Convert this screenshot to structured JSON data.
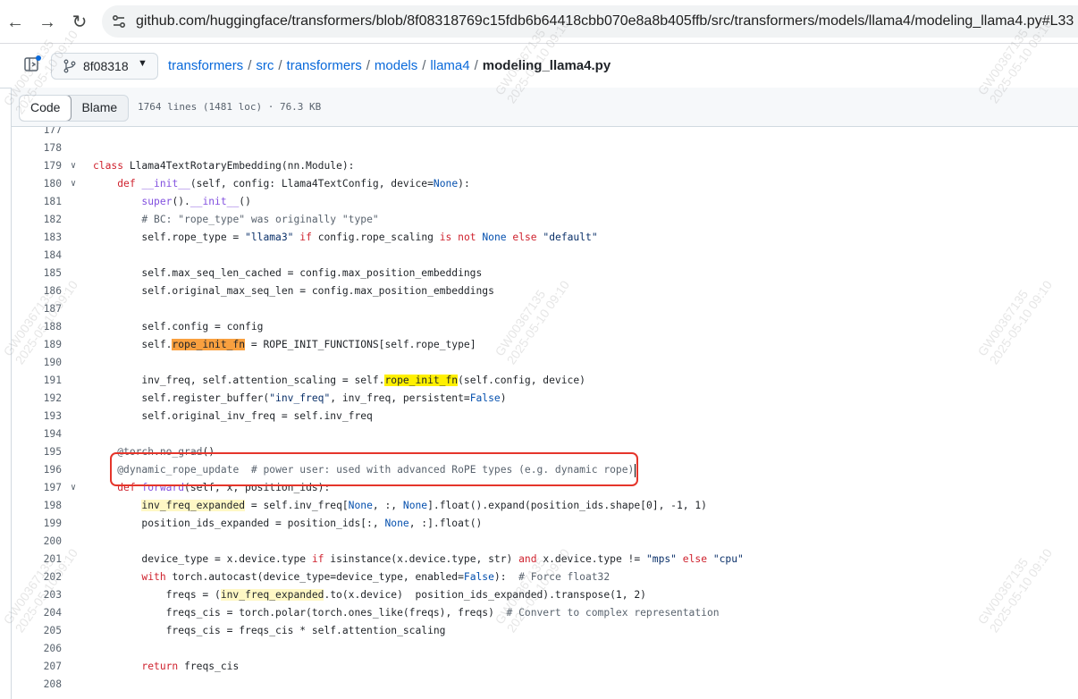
{
  "browser": {
    "url": "github.com/huggingface/transformers/blob/8f08318769c15fdb6b64418cbb070e8a8b405ffb/src/transformers/models/llama4/modeling_llama4.py#L33"
  },
  "repo": {
    "branch": "8f08318",
    "breadcrumb": [
      "transformers",
      "src",
      "transformers",
      "models",
      "llama4"
    ],
    "file": "modeling_llama4.py"
  },
  "file_toolbar": {
    "code_label": "Code",
    "blame_label": "Blame",
    "info": "1764 lines (1481 loc) · 76.3 KB"
  },
  "watermark": {
    "id": "GW00367135",
    "time": "2025-05-10 09:10"
  },
  "code_lines": [
    {
      "n": "177",
      "src": ""
    },
    {
      "n": "178",
      "src": ""
    },
    {
      "n": "179",
      "src": "class Llama4TextRotaryEmbedding(nn.Module):"
    },
    {
      "n": "180",
      "src": "    def __init__(self, config: Llama4TextConfig, device=None):"
    },
    {
      "n": "181",
      "src": "        super().__init__()"
    },
    {
      "n": "182",
      "src": "        # BC: \"rope_type\" was originally \"type\""
    },
    {
      "n": "183",
      "src": "        self.rope_type = \"llama3\" if config.rope_scaling is not None else \"default\""
    },
    {
      "n": "184",
      "src": ""
    },
    {
      "n": "185",
      "src": "        self.max_seq_len_cached = config.max_position_embeddings"
    },
    {
      "n": "186",
      "src": "        self.original_max_seq_len = config.max_position_embeddings"
    },
    {
      "n": "187",
      "src": ""
    },
    {
      "n": "188",
      "src": "        self.config = config"
    },
    {
      "n": "189",
      "src": "        self.rope_init_fn = ROPE_INIT_FUNCTIONS[self.rope_type]"
    },
    {
      "n": "190",
      "src": ""
    },
    {
      "n": "191",
      "src": "        inv_freq, self.attention_scaling = self.rope_init_fn(self.config, device)"
    },
    {
      "n": "192",
      "src": "        self.register_buffer(\"inv_freq\", inv_freq, persistent=False)"
    },
    {
      "n": "193",
      "src": "        self.original_inv_freq = self.inv_freq"
    },
    {
      "n": "194",
      "src": ""
    },
    {
      "n": "195",
      "src": "    @torch.no_grad()"
    },
    {
      "n": "196",
      "src": "    @dynamic_rope_update  # power user: used with advanced RoPE types (e.g. dynamic rope)"
    },
    {
      "n": "197",
      "src": "    def forward(self, x, position_ids):"
    },
    {
      "n": "198",
      "src": "        inv_freq_expanded = self.inv_freq[None, :, None].float().expand(position_ids.shape[0], -1, 1)"
    },
    {
      "n": "199",
      "src": "        position_ids_expanded = position_ids[:, None, :].float()"
    },
    {
      "n": "200",
      "src": ""
    },
    {
      "n": "201",
      "src": "        device_type = x.device.type if isinstance(x.device.type, str) and x.device.type != \"mps\" else \"cpu\""
    },
    {
      "n": "202",
      "src": "        with torch.autocast(device_type=device_type, enabled=False):  # Force float32"
    },
    {
      "n": "203",
      "src": "            freqs = (inv_freq_expanded.to(x.device) @ position_ids_expanded).transpose(1, 2)"
    },
    {
      "n": "204",
      "src": "            freqs_cis = torch.polar(torch.ones_like(freqs), freqs)  # Convert to complex representation"
    },
    {
      "n": "205",
      "src": "            freqs_cis = freqs_cis * self.attention_scaling"
    },
    {
      "n": "206",
      "src": ""
    },
    {
      "n": "207",
      "src": "        return freqs_cis"
    },
    {
      "n": "208",
      "src": ""
    }
  ],
  "colors": {
    "keyword": "#cf222e",
    "function": "#8250df",
    "comment": "#59636e",
    "string": "#0a3069",
    "builtin": "#0550ae",
    "highlight_orange": "#f9a03f",
    "highlight_yellow": "#fff000",
    "annotation_box": "#e5352b"
  }
}
